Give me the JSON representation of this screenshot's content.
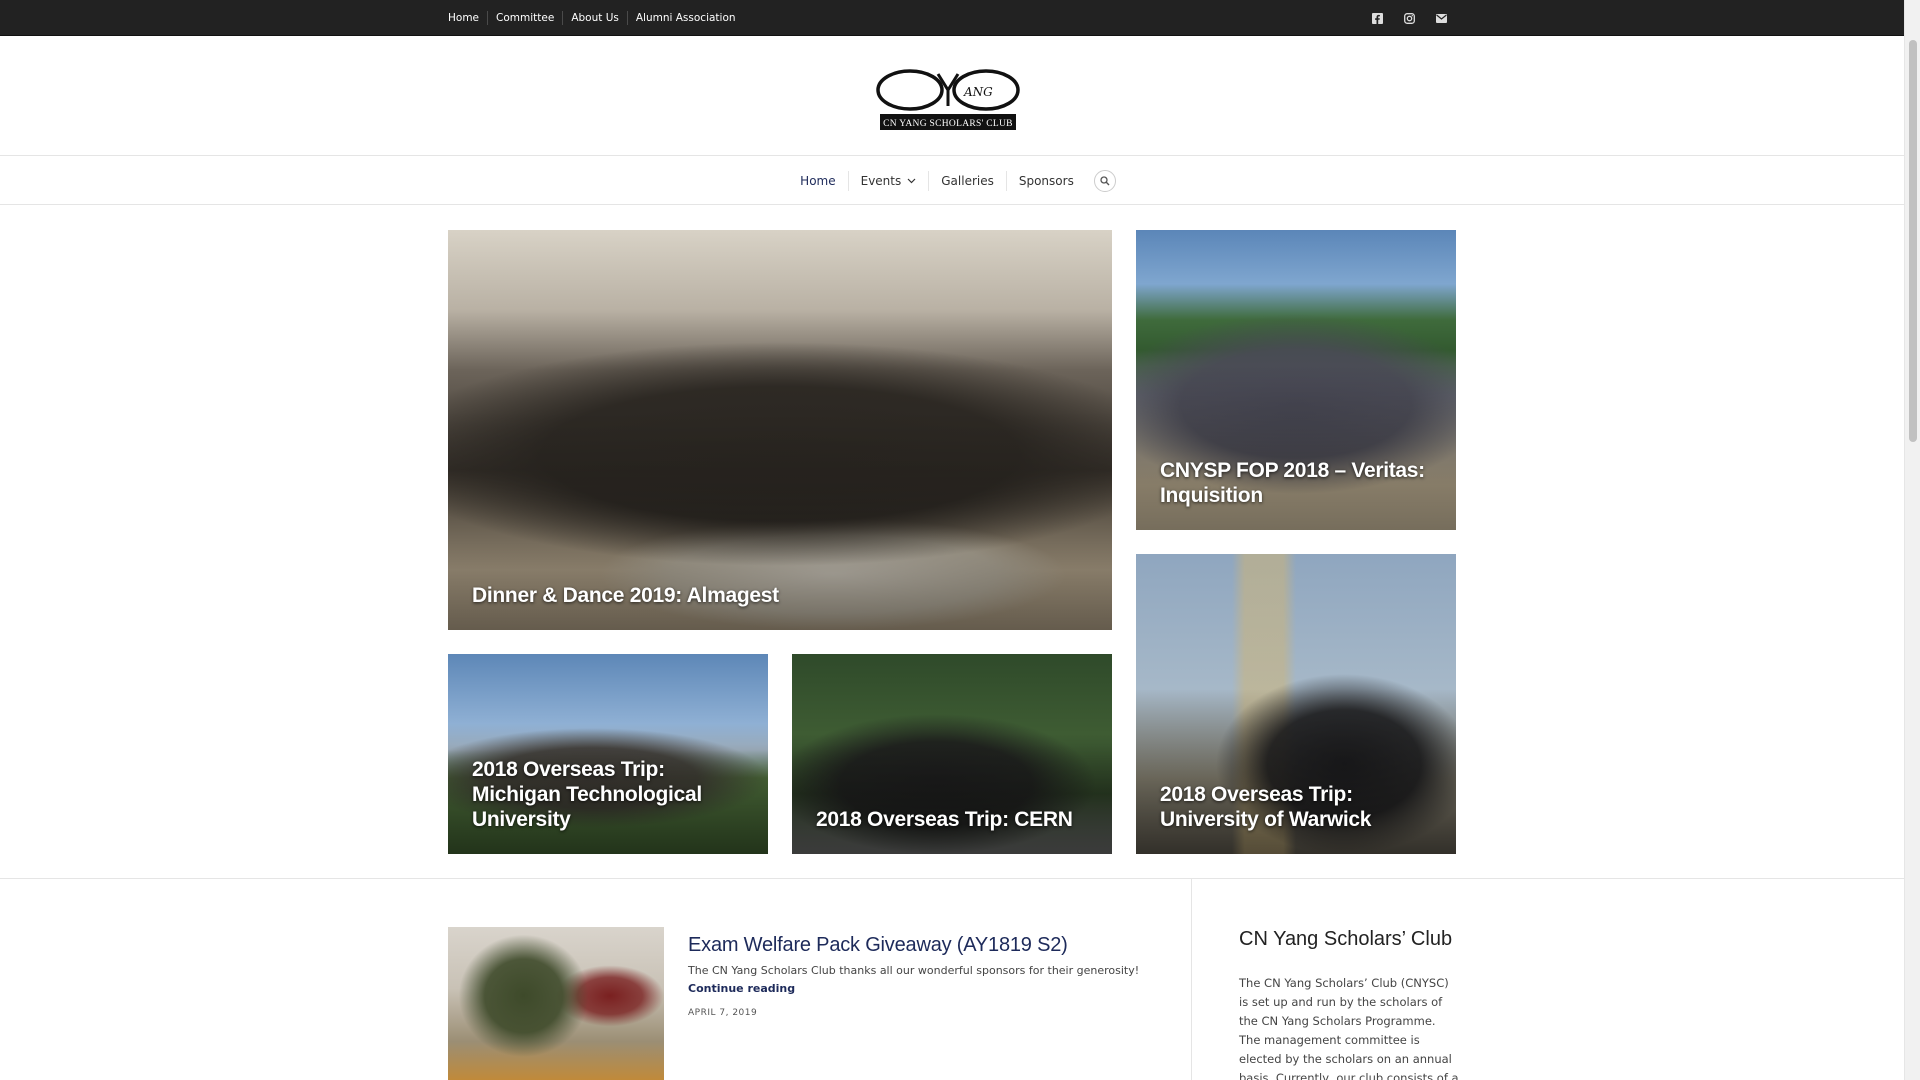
{
  "topbar": {
    "links": [
      "Home",
      "Committee",
      "About Us",
      "Alumni Association"
    ],
    "social": [
      {
        "icon": "facebook-icon",
        "glyph": "f"
      },
      {
        "icon": "instagram-icon",
        "glyph": "◎"
      },
      {
        "icon": "mail-icon",
        "glyph": "✉"
      }
    ]
  },
  "logo": {
    "wordmark": "CNYANG",
    "text": "CN YANG SCHOLARS' CLUB"
  },
  "mainnav": {
    "items": [
      "Home",
      "Events",
      "Galleries",
      "Sponsors"
    ],
    "events_caret": "⌄"
  },
  "featured": [
    {
      "title": "Dinner & Dance 2019: Almagest"
    },
    {
      "title": "CNYSP FOP 2018 – Veritas: Inquisition"
    },
    {
      "title": "2018 Overseas Trip: Michigan Technological University"
    },
    {
      "title": "2018 Overseas Trip: CERN"
    },
    {
      "title": "2018 Overseas Trip: University of Warwick"
    }
  ],
  "post": {
    "title": "Exam Welfare Pack Giveaway (AY1819 S2)",
    "excerpt": "The CN Yang Scholars Club thanks all our wonderful sponsors for their generosity!",
    "more": "Continue reading",
    "date": "APRIL 7, 2019"
  },
  "sidebar": {
    "title": "CN Yang Scholars’ Club",
    "text": "The CN Yang Scholars’ Club (CNYSC) is set up and run by the scholars of the CN Yang Scholars Programme. The management committee is elected by the scholars on an annual basis. Currently, our club consists of a total of"
  },
  "colors": {
    "topbar_bg": "#222222",
    "link_accent": "#1d2a5a"
  }
}
